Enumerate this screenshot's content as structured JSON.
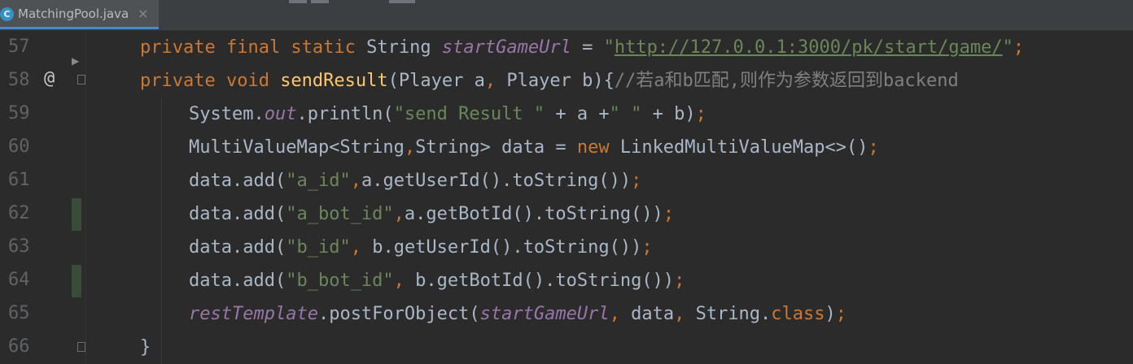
{
  "tab": {
    "icon_letter": "C",
    "file_name": "MatchingPool.java",
    "close_glyph": "×"
  },
  "gutter": {
    "override_marker": "@",
    "run_marker": "▶"
  },
  "lines": [
    {
      "number": "57",
      "segments": [
        {
          "t": "private final static ",
          "c": "kw"
        },
        {
          "t": "String ",
          "c": "plain"
        },
        {
          "t": "startGameUrl",
          "c": "fld"
        },
        {
          "t": " = ",
          "c": "plain"
        },
        {
          "t": "\"",
          "c": "str"
        },
        {
          "t": "http://127.0.0.1:3000/pk/start/game/",
          "c": "url"
        },
        {
          "t": "\"",
          "c": "str"
        },
        {
          "t": ";",
          "c": "kw"
        }
      ]
    },
    {
      "number": "58",
      "segments": [
        {
          "t": "private void ",
          "c": "kw"
        },
        {
          "t": "sendResult",
          "c": "fn"
        },
        {
          "t": "(Player a",
          "c": "plain"
        },
        {
          "t": ", ",
          "c": "kw"
        },
        {
          "t": "Player b){",
          "c": "plain"
        },
        {
          "t": "//若a和b匹配,则作为参数返回到backend",
          "c": "cmt"
        }
      ]
    },
    {
      "number": "59",
      "segments": [
        {
          "t": "System.",
          "c": "plain"
        },
        {
          "t": "out",
          "c": "fld"
        },
        {
          "t": ".println(",
          "c": "plain"
        },
        {
          "t": "\"send Result \"",
          "c": "str"
        },
        {
          "t": " + a +",
          "c": "plain"
        },
        {
          "t": "\" \"",
          "c": "str"
        },
        {
          "t": " + b)",
          "c": "plain"
        },
        {
          "t": ";",
          "c": "kw"
        }
      ]
    },
    {
      "number": "60",
      "segments": [
        {
          "t": "MultiValueMap<String",
          "c": "plain"
        },
        {
          "t": ",",
          "c": "kw"
        },
        {
          "t": "String> data = ",
          "c": "plain"
        },
        {
          "t": "new ",
          "c": "kw"
        },
        {
          "t": "LinkedMultiValueMap<>()",
          "c": "plain"
        },
        {
          "t": ";",
          "c": "kw"
        }
      ]
    },
    {
      "number": "61",
      "segments": [
        {
          "t": "data.add(",
          "c": "plain"
        },
        {
          "t": "\"a_id\"",
          "c": "str"
        },
        {
          "t": ",",
          "c": "kw"
        },
        {
          "t": "a.getUserId().toString())",
          "c": "plain"
        },
        {
          "t": ";",
          "c": "kw"
        }
      ]
    },
    {
      "number": "62",
      "segments": [
        {
          "t": "data.add(",
          "c": "plain"
        },
        {
          "t": "\"a_bot_id\"",
          "c": "str"
        },
        {
          "t": ",",
          "c": "kw"
        },
        {
          "t": "a.getBotId().toString())",
          "c": "plain"
        },
        {
          "t": ";",
          "c": "kw"
        }
      ]
    },
    {
      "number": "63",
      "segments": [
        {
          "t": "data.add(",
          "c": "plain"
        },
        {
          "t": "\"b_id\"",
          "c": "str"
        },
        {
          "t": ", ",
          "c": "kw"
        },
        {
          "t": "b.getUserId().toString())",
          "c": "plain"
        },
        {
          "t": ";",
          "c": "kw"
        }
      ]
    },
    {
      "number": "64",
      "segments": [
        {
          "t": "data.add(",
          "c": "plain"
        },
        {
          "t": "\"b_bot_id\"",
          "c": "str"
        },
        {
          "t": ", ",
          "c": "kw"
        },
        {
          "t": "b.getBotId().toString())",
          "c": "plain"
        },
        {
          "t": ";",
          "c": "kw"
        }
      ]
    },
    {
      "number": "65",
      "segments": [
        {
          "t": "restTemplate",
          "c": "fld"
        },
        {
          "t": ".postForObject(",
          "c": "plain"
        },
        {
          "t": "startGameUrl",
          "c": "fld"
        },
        {
          "t": ", ",
          "c": "kw"
        },
        {
          "t": "data",
          "c": "plain"
        },
        {
          "t": ", ",
          "c": "kw"
        },
        {
          "t": "String.",
          "c": "plain"
        },
        {
          "t": "class",
          "c": "kw"
        },
        {
          "t": ")",
          "c": "plain"
        },
        {
          "t": ";",
          "c": "kw"
        }
      ]
    },
    {
      "number": "66",
      "segments": [
        {
          "t": "}",
          "c": "plain"
        }
      ]
    }
  ],
  "colors": {
    "background": "#2b2b2b",
    "keyword": "#cc7832",
    "field": "#9876aa",
    "method": "#ffc66d",
    "string": "#6a8759",
    "comment": "#808080",
    "default_text": "#a9b7c6",
    "line_number": "#606366",
    "tab_accent": "#4a88c7"
  }
}
